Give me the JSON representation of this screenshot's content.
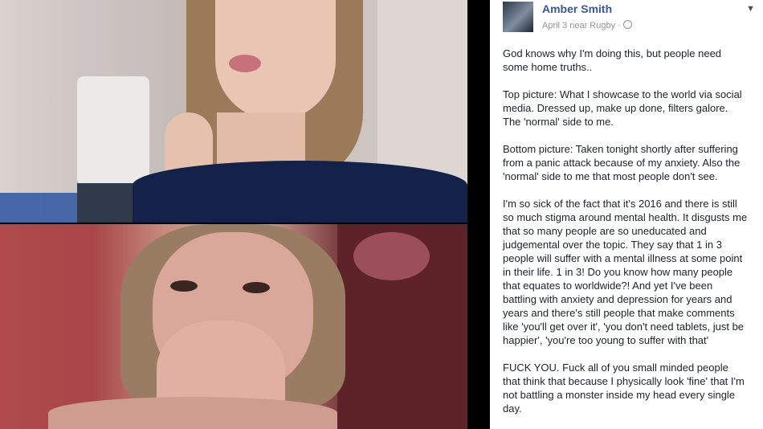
{
  "post": {
    "author": "Amber Smith",
    "meta": "April 3 near Rugby ·",
    "icons": {
      "avatar": "profile-photo",
      "audience": "globe-icon",
      "menu": "chevron-down-icon"
    },
    "paragraphs": [
      "God knows why I'm doing this, but people need\nsome home truths..",
      "Top picture: What I showcase to the world via social\nmedia. Dressed up, make up done, filters galore.\nThe 'normal' side to me.",
      "Bottom picture: Taken tonight shortly after suffering\nfrom a panic attack because of my anxiety. Also the\n'normal' side to me that most people don't see.",
      "I'm so sick of the fact that it's 2016 and there is still\nso much stigma around mental health. It disgusts me\nthat so many people are so uneducated and\njudgemental over the topic. They say that 1 in 3\npeople will suffer with a mental illness at some point\nin their life. 1 in 3! Do you know how many people\nthat equates to worldwide?! And yet I've been\nbattling with anxiety and depression for years and\nyears and there's still people that make comments\nlike 'you'll get over it', 'you don't need tablets, just be\nhappier', 'you're too young to suffer with that'",
      "FUCK YOU. Fuck all of you small minded people\nthat think that because I physically look 'fine' that I'm\nnot battling a monster inside my head every single\nday."
    ]
  },
  "colors": {
    "link": "#3b5998",
    "meta": "#90949c",
    "text": "#1d2129"
  }
}
